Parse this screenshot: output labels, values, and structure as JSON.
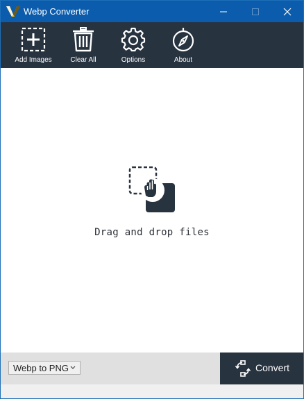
{
  "window": {
    "title": "Webp Converter"
  },
  "toolbar": {
    "items": [
      {
        "label": "Add Images",
        "icon": "add-images-icon"
      },
      {
        "label": "Clear All",
        "icon": "trash-icon"
      },
      {
        "label": "Options",
        "icon": "gear-icon"
      },
      {
        "label": "About",
        "icon": "compass-icon"
      }
    ]
  },
  "dropzone": {
    "text": "Drag and drop files",
    "icon": "drag-drop-icon"
  },
  "bottom": {
    "format_selected": "Webp to PNG",
    "convert_label": "Convert",
    "convert_icon": "convert-icon"
  },
  "colors": {
    "titlebar": "#0b5cad",
    "toolbar": "#283340",
    "convert_button": "#283340",
    "bottom_bar": "#e0e0e0"
  }
}
